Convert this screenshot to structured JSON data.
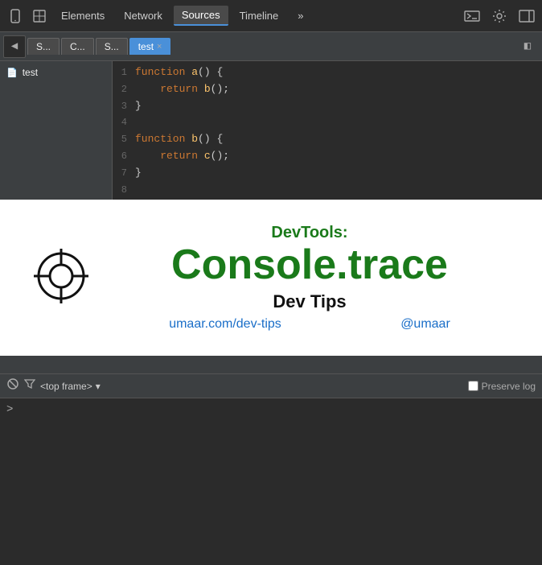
{
  "topbar": {
    "tabs": [
      {
        "label": "Elements",
        "active": false
      },
      {
        "label": "Network",
        "active": false
      },
      {
        "label": "Sources",
        "active": true
      },
      {
        "label": "Timeline",
        "active": false
      },
      {
        "label": "»",
        "active": false
      }
    ],
    "icons": {
      "mobile": "☐",
      "cursor": "⊕",
      "more": "»",
      "terminal": "⊟",
      "settings": "⚙",
      "screencast": "▭",
      "dock": "◫"
    }
  },
  "filetabs": {
    "nav_left": "◀",
    "tabs": [
      {
        "label": "S...",
        "active": false
      },
      {
        "label": "C...",
        "active": false
      },
      {
        "label": "S...",
        "active": false
      }
    ],
    "open_file": "test",
    "close_x": "×",
    "collapse": "◧"
  },
  "sidebar": {
    "items": [
      {
        "label": "test",
        "icon": "📄"
      }
    ]
  },
  "code": {
    "lines": [
      {
        "num": "1",
        "text": "function a() {"
      },
      {
        "num": "2",
        "text": "    return b();"
      },
      {
        "num": "3",
        "text": "}"
      },
      {
        "num": "4",
        "text": ""
      },
      {
        "num": "5",
        "text": "function b() {"
      },
      {
        "num": "6",
        "text": "    return c();"
      },
      {
        "num": "7",
        "text": "}"
      },
      {
        "num": "8",
        "text": ""
      }
    ]
  },
  "overlay": {
    "subtitle": "DevTools:",
    "title": "Console.trace",
    "tagline": "Dev Tips",
    "link1": "umaar.com/dev-tips",
    "link2": "@umaar"
  },
  "console": {
    "icons": {
      "clear": "🚫",
      "filter": "▾",
      "verbose": "▾"
    },
    "frame_label": "<top frame>",
    "preserve_log_label": "Preserve log",
    "prompt_caret": ">"
  }
}
